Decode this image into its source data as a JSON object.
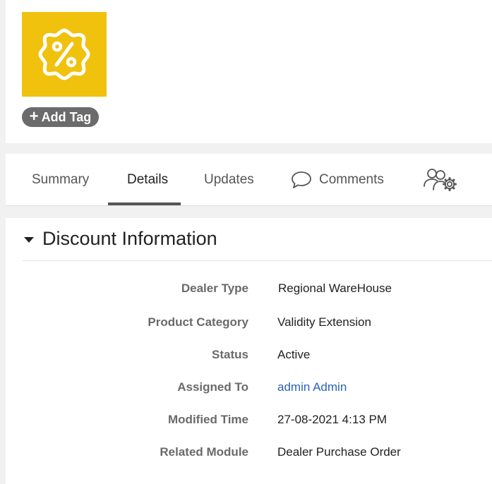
{
  "record": {
    "icon": "discount-badge-icon",
    "icon_bg": "#f0c20e",
    "add_tag_label": "Add Tag"
  },
  "tabs": [
    {
      "label": "Summary"
    },
    {
      "label": "Details",
      "active": true
    },
    {
      "label": "Updates"
    },
    {
      "label": "Comments",
      "icon": "comment-bubble-icon"
    },
    {
      "label": "",
      "icon": "team-settings-icon"
    }
  ],
  "section": {
    "title": "Discount Information"
  },
  "fields": [
    {
      "label": "Dealer Type",
      "value": "Regional WareHouse"
    },
    {
      "label": "Product Category",
      "value": "Validity Extension"
    },
    {
      "label": "Status",
      "value": "Active"
    },
    {
      "label": "Assigned To",
      "value": "admin Admin",
      "link": true
    },
    {
      "label": "Modified Time",
      "value": "27-08-2021 4:13 PM"
    },
    {
      "label": "Related Module",
      "value": "Dealer Purchase Order"
    }
  ],
  "colors": {
    "accent": "#f0c20e",
    "link": "#2a62b8",
    "tab_underline": "#555555"
  }
}
